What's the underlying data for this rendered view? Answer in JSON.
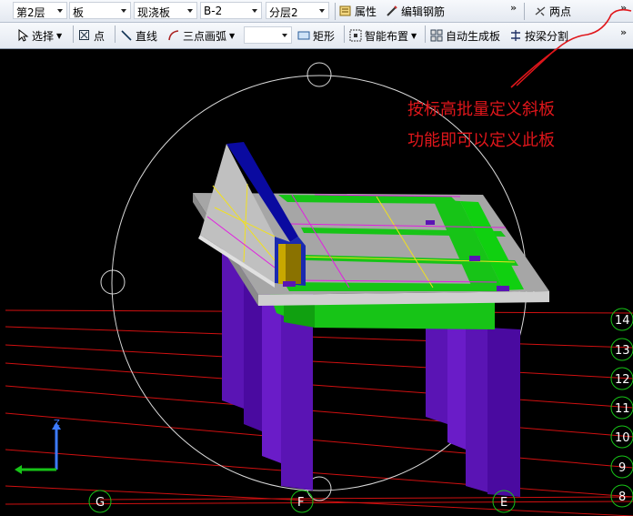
{
  "toolbar1": {
    "floor": "第2层",
    "component_type": "板",
    "component_subtype": "现浇板",
    "component_name": "B-2",
    "layer": "分层2",
    "properties_label": "属性",
    "edit_rebar_label": "编辑钢筋",
    "two_points_label": "两点",
    "more_icon": "chevron-double-right"
  },
  "toolbar2": {
    "select_label": "选择",
    "point_label": "点",
    "line_label": "直线",
    "arc_label": "三点画弧",
    "rect_label": "矩形",
    "smart_layout_label": "智能布置",
    "auto_slab_label": "自动生成板",
    "split_by_beam_label": "按梁分割",
    "more_icon": "chevron-double-right"
  },
  "annotation": {
    "line1": "按标高批量定义斜板",
    "line2": "功能即可以定义此板",
    "color": "#e0161b"
  },
  "grid_axes": {
    "columns": [
      "G",
      "F",
      "E"
    ],
    "rows": [
      "14",
      "13",
      "12",
      "11",
      "10",
      "9",
      "8"
    ]
  },
  "coordinate_axes": {
    "z": "Z"
  },
  "colors": {
    "slab": "#a6a6a6",
    "beam": "#17c417",
    "column": "#5a14b4",
    "inclined_beam": "#0a0aa0",
    "grid": "#d01010",
    "rebar_yellow": "#f0e020",
    "rebar_magenta": "#e020e0"
  }
}
